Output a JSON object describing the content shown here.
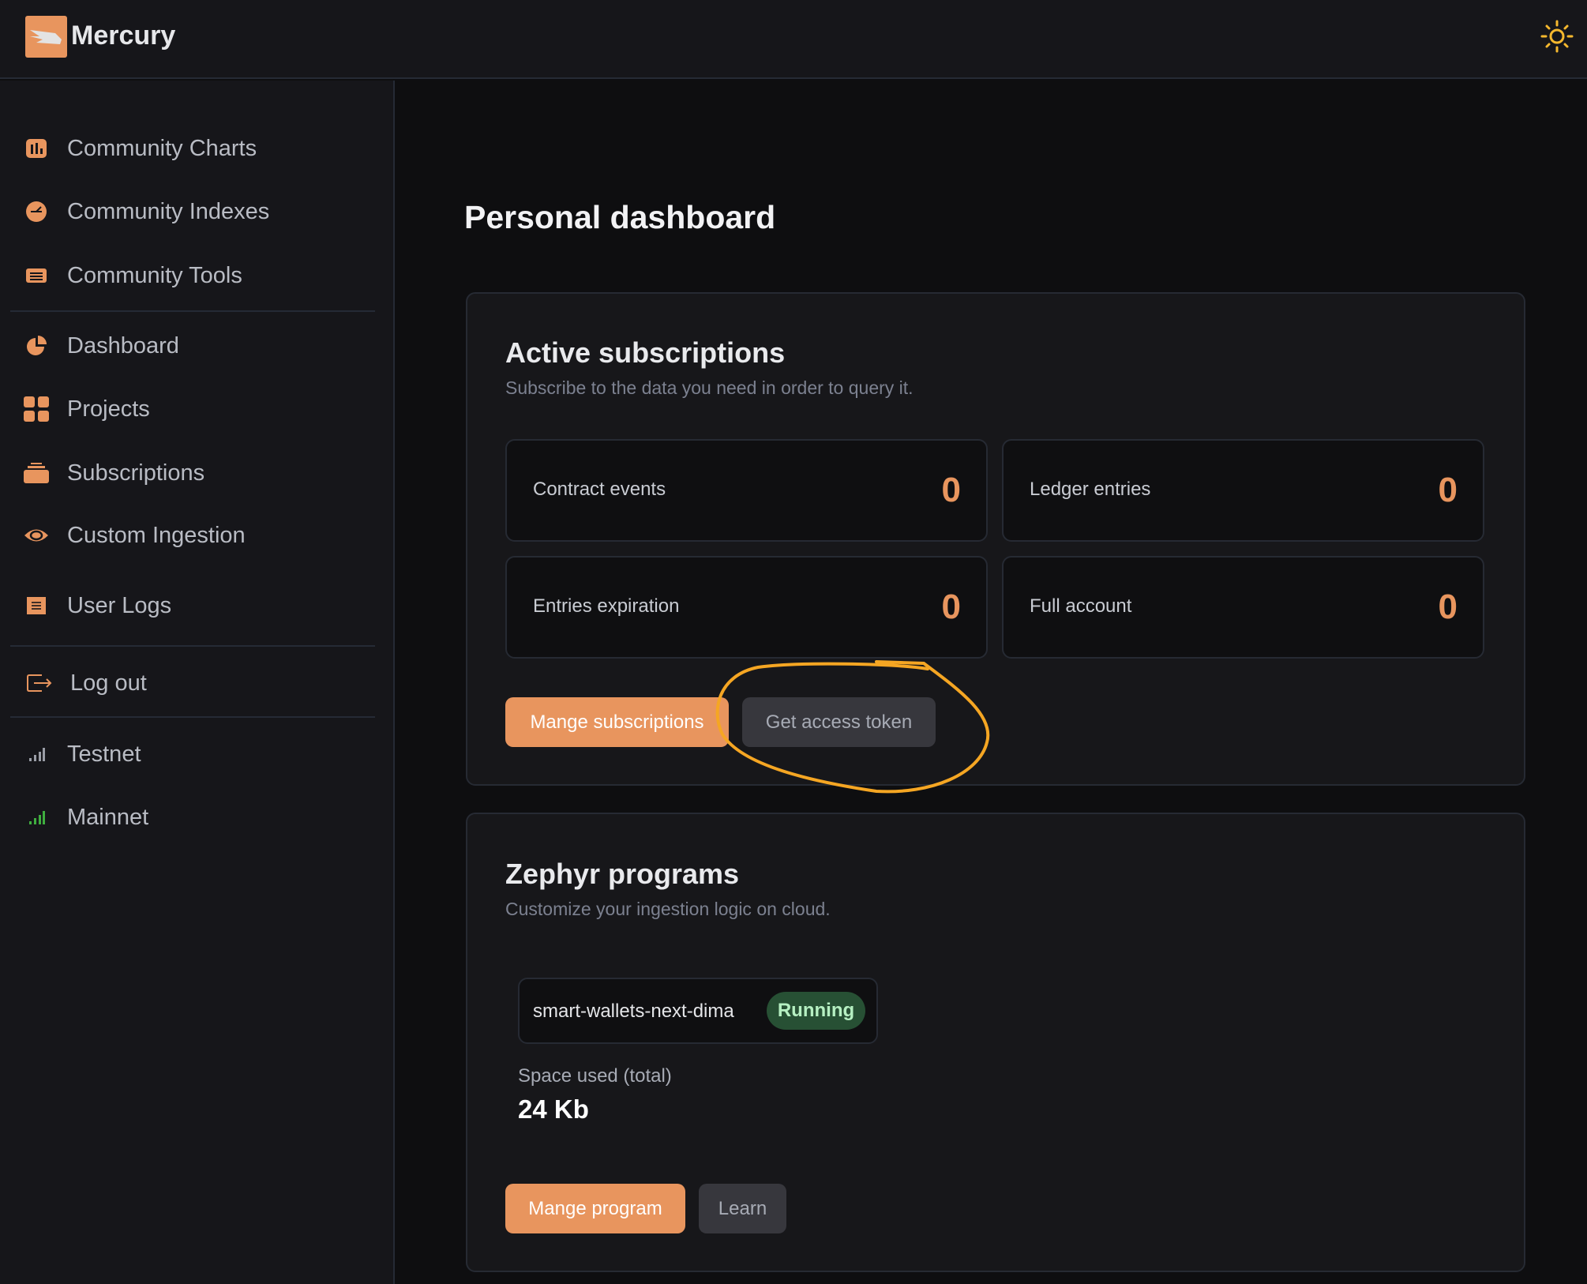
{
  "header": {
    "brand": "Mercury",
    "theme_icon": "sun-icon"
  },
  "sidebar": {
    "items": [
      {
        "label": "Community Charts",
        "icon": "bar-chart-icon"
      },
      {
        "label": "Community Indexes",
        "icon": "gauge-icon"
      },
      {
        "label": "Community Tools",
        "icon": "toolbox-icon"
      },
      {
        "label": "Dashboard",
        "icon": "pie-chart-icon"
      },
      {
        "label": "Projects",
        "icon": "grid-icon"
      },
      {
        "label": "Subscriptions",
        "icon": "stack-icon"
      },
      {
        "label": "Custom Ingestion",
        "icon": "eye-icon"
      },
      {
        "label": "User Logs",
        "icon": "log-icon"
      },
      {
        "label": "Log out",
        "icon": "logout-icon"
      },
      {
        "label": "Testnet",
        "icon": "signal-icon"
      },
      {
        "label": "Mainnet",
        "icon": "signal-icon"
      }
    ]
  },
  "main": {
    "title": "Personal dashboard",
    "subscriptions": {
      "title": "Active subscriptions",
      "subtitle": "Subscribe to the data you need in order to query it.",
      "stats": [
        {
          "label": "Contract events",
          "value": "0"
        },
        {
          "label": "Ledger entries",
          "value": "0"
        },
        {
          "label": "Entries expiration",
          "value": "0"
        },
        {
          "label": "Full account",
          "value": "0"
        }
      ],
      "manage_label": "Mange subscriptions",
      "token_label": "Get access token"
    },
    "zephyr": {
      "title": "Zephyr programs",
      "subtitle": "Customize your ingestion logic on cloud.",
      "program_name": "smart-wallets-next-dima",
      "status": "Running",
      "space_label": "Space used (total)",
      "space_value": "24 Kb",
      "manage_label": "Mange program",
      "learn_label": "Learn"
    }
  },
  "colors": {
    "accent": "#e8955e",
    "annotation": "#f5a623",
    "running": "#275034",
    "mainnet": "#3fae3f"
  }
}
